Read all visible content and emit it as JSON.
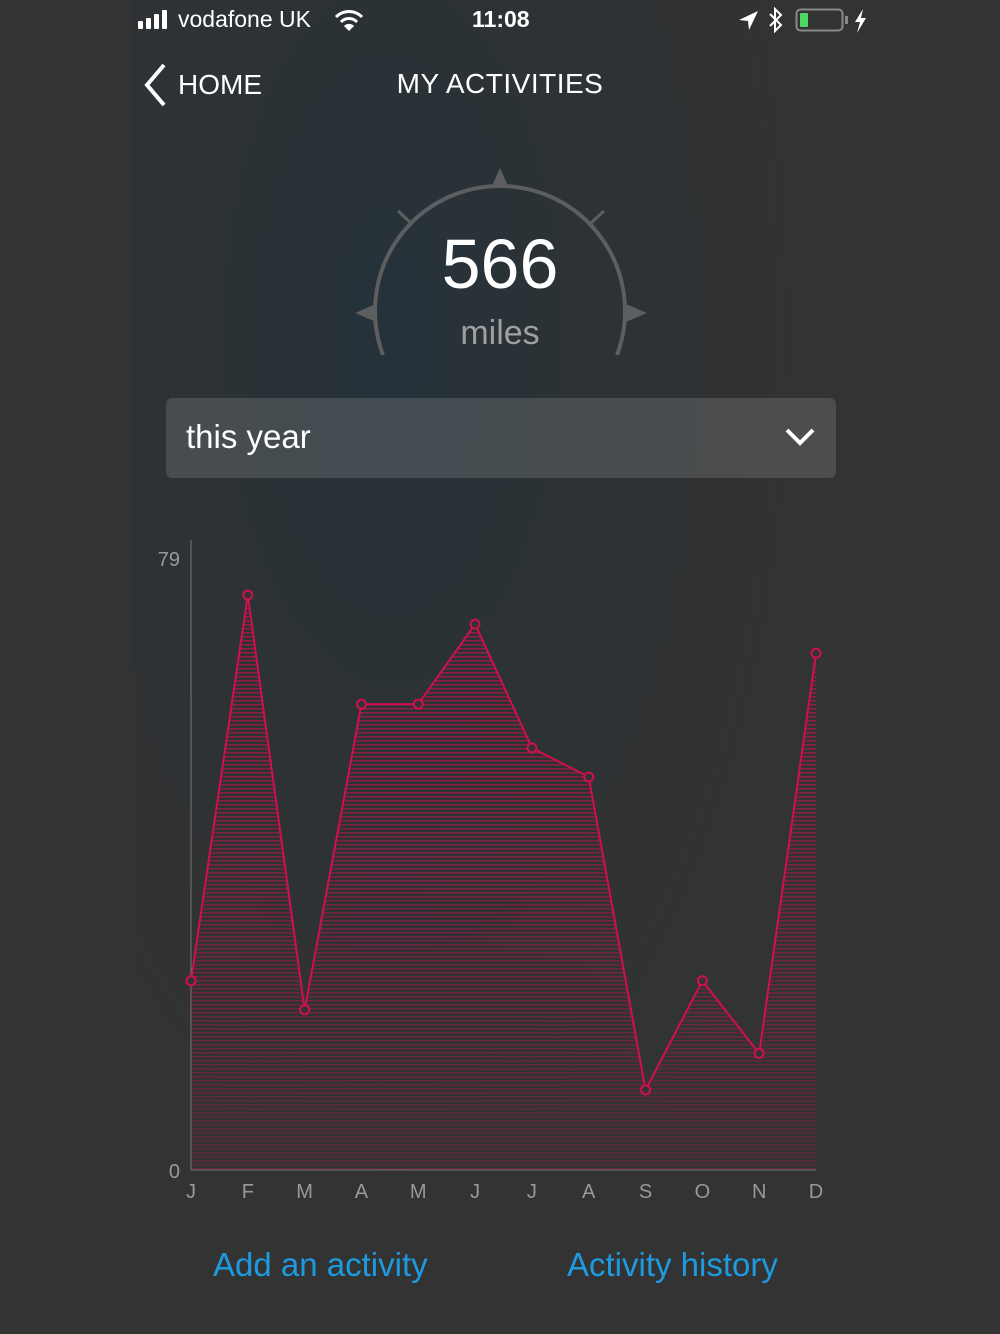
{
  "status_bar": {
    "carrier": "vodafone UK",
    "time": "11:08",
    "battery_level": 0.2,
    "icons": [
      "signal-icon",
      "wifi-icon",
      "location-icon",
      "bluetooth-icon",
      "battery-icon",
      "charging-icon"
    ]
  },
  "nav": {
    "back_label": "HOME",
    "title": "MY ACTIVITIES"
  },
  "gauge": {
    "value": "566",
    "unit": "miles"
  },
  "period_select": {
    "value": "this year"
  },
  "colors": {
    "accent": "#d0104c",
    "link": "#1e9be0"
  },
  "chart_data": {
    "type": "area",
    "categories": [
      "J",
      "F",
      "M",
      "A",
      "M",
      "J",
      "J",
      "A",
      "S",
      "O",
      "N",
      "D"
    ],
    "values": [
      26,
      79,
      22,
      64,
      64,
      75,
      58,
      54,
      11,
      26,
      16,
      71
    ],
    "y_ticks": [
      "0",
      "79"
    ],
    "ylim": [
      0,
      79
    ],
    "grid": false
  },
  "actions": {
    "add": "Add an activity",
    "history": "Activity history"
  }
}
